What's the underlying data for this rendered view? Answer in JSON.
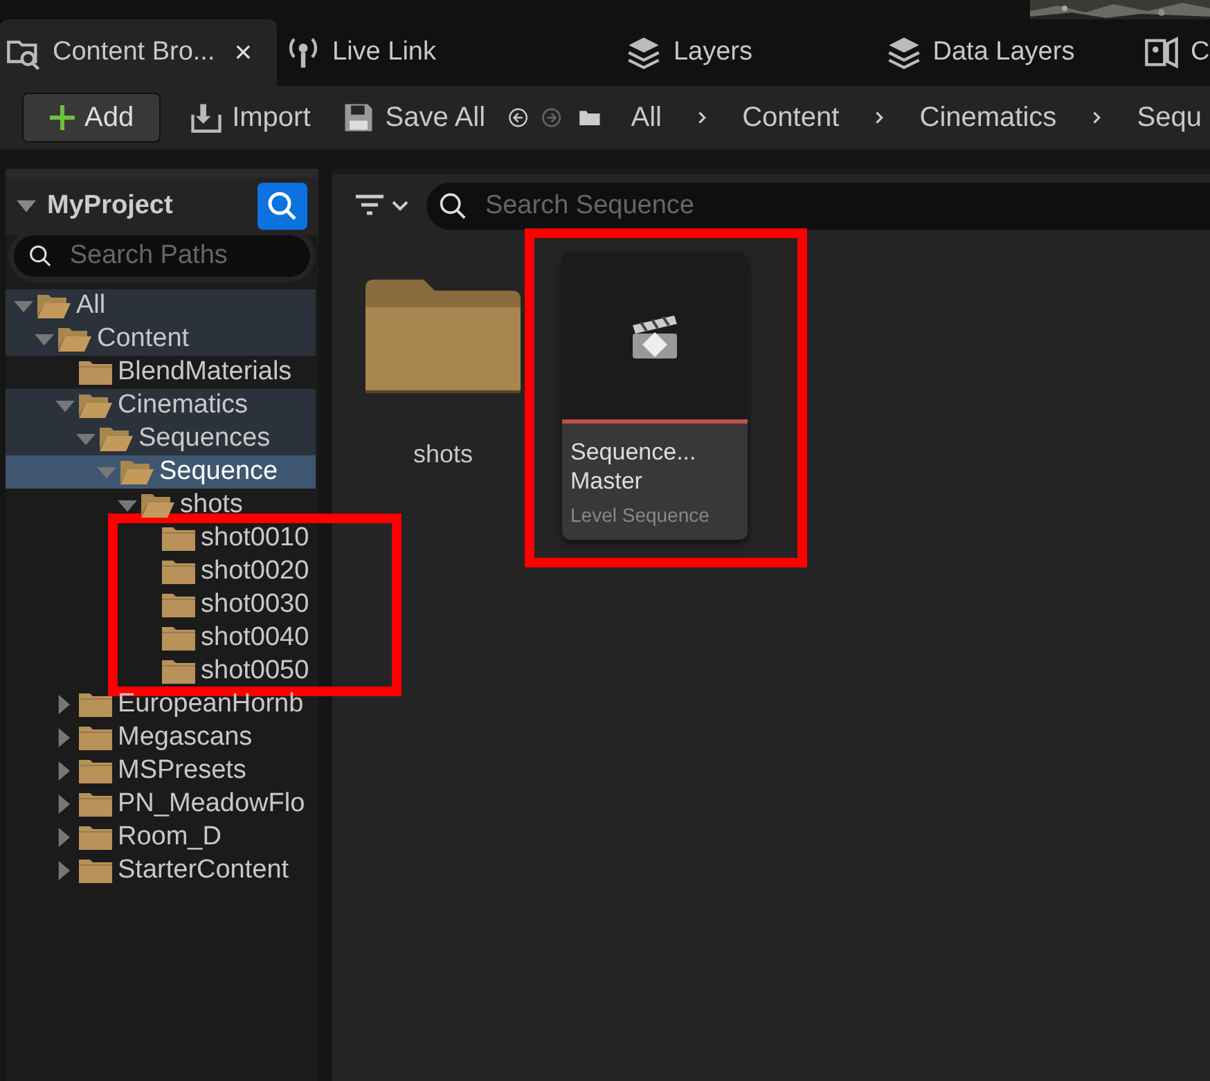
{
  "tabs": [
    {
      "label": "Content Bro...",
      "selected": true,
      "close": "×"
    },
    {
      "label": "Live Link",
      "selected": false
    },
    {
      "label": "Layers",
      "selected": false
    },
    {
      "label": "Data Layers",
      "selected": false
    },
    {
      "label": "C",
      "selected": false
    }
  ],
  "toolbar": {
    "add": "Add",
    "import": "Import",
    "save_all": "Save All",
    "back_enabled": true,
    "forward_enabled": false,
    "breadcrumbs": [
      "All",
      "Content",
      "Cinematics",
      "Sequ"
    ]
  },
  "sidebar": {
    "title": "MyProject",
    "search": {
      "placeholder": "Search Paths"
    },
    "tree": [
      {
        "label": "All",
        "expanded": true,
        "in_path": true,
        "selected": false,
        "children": [
          {
            "label": "Content",
            "expanded": true,
            "in_path": true,
            "selected": false,
            "children": [
              {
                "label": "BlendMaterials",
                "expanded": false,
                "in_path": false,
                "selected": false
              },
              {
                "label": "Cinematics",
                "expanded": true,
                "in_path": true,
                "selected": false,
                "children": [
                  {
                    "label": "Sequences",
                    "expanded": true,
                    "in_path": true,
                    "selected": false,
                    "children": [
                      {
                        "label": "Sequence",
                        "expanded": true,
                        "selected": true,
                        "children": [
                          {
                            "label": "shots",
                            "expanded": true,
                            "in_path": false,
                            "selected": false,
                            "children": [
                              {
                                "label": "shot0010",
                                "expanded": false,
                                "in_path": false,
                                "selected": false
                              },
                              {
                                "label": "shot0020",
                                "expanded": false,
                                "in_path": false,
                                "selected": false
                              },
                              {
                                "label": "shot0030",
                                "expanded": false,
                                "in_path": false,
                                "selected": false
                              },
                              {
                                "label": "shot0040",
                                "expanded": false,
                                "in_path": false,
                                "selected": false
                              },
                              {
                                "label": "shot0050",
                                "expanded": false,
                                "in_path": false,
                                "selected": false
                              }
                            ]
                          }
                        ]
                      }
                    ]
                  }
                ]
              },
              {
                "label": "EuropeanHornb",
                "expanded": false,
                "in_path": false,
                "selected": false,
                "collapsible": true
              },
              {
                "label": "Megascans",
                "expanded": false,
                "in_path": false,
                "selected": false,
                "collapsible": true
              },
              {
                "label": "MSPresets",
                "expanded": false,
                "in_path": false,
                "selected": false,
                "collapsible": true
              },
              {
                "label": "PN_MeadowFlo",
                "expanded": false,
                "in_path": false,
                "selected": false,
                "collapsible": true
              },
              {
                "label": "Room_D",
                "expanded": false,
                "in_path": false,
                "selected": false,
                "collapsible": true
              },
              {
                "label": "StarterContent",
                "expanded": false,
                "in_path": false,
                "selected": false,
                "collapsible": true
              }
            ]
          }
        ]
      }
    ]
  },
  "content": {
    "search": {
      "placeholder": "Search Sequence"
    },
    "items": [
      {
        "kind": "folder",
        "name": "shots"
      },
      {
        "kind": "asset",
        "name": "Sequence... Master",
        "type": "Level Sequence",
        "color": "#c0504d"
      }
    ]
  }
}
